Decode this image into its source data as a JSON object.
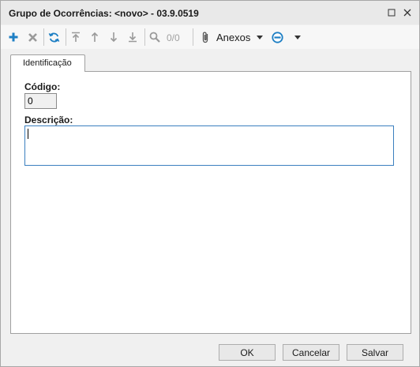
{
  "window": {
    "title": "Grupo de Ocorrências: <novo> - 03.9.0519"
  },
  "toolbar": {
    "add_icon": "plus-icon",
    "delete_icon": "x-icon",
    "refresh_icon": "refresh-icon",
    "first_icon": "arrow-up-first-icon",
    "prev_icon": "arrow-up-icon",
    "next_icon": "arrow-down-icon",
    "last_icon": "arrow-down-last-icon",
    "search_icon": "search-icon",
    "counter": "0/0",
    "anexos_label": "Anexos",
    "accent_color": "#1e7fc4"
  },
  "tabs": [
    {
      "label": "Identificação"
    }
  ],
  "form": {
    "codigo_label": "Código:",
    "codigo_value": "0",
    "descricao_label": "Descrição:",
    "descricao_value": ""
  },
  "footer": {
    "ok_label": "OK",
    "cancel_label": "Cancelar",
    "save_label": "Salvar"
  }
}
